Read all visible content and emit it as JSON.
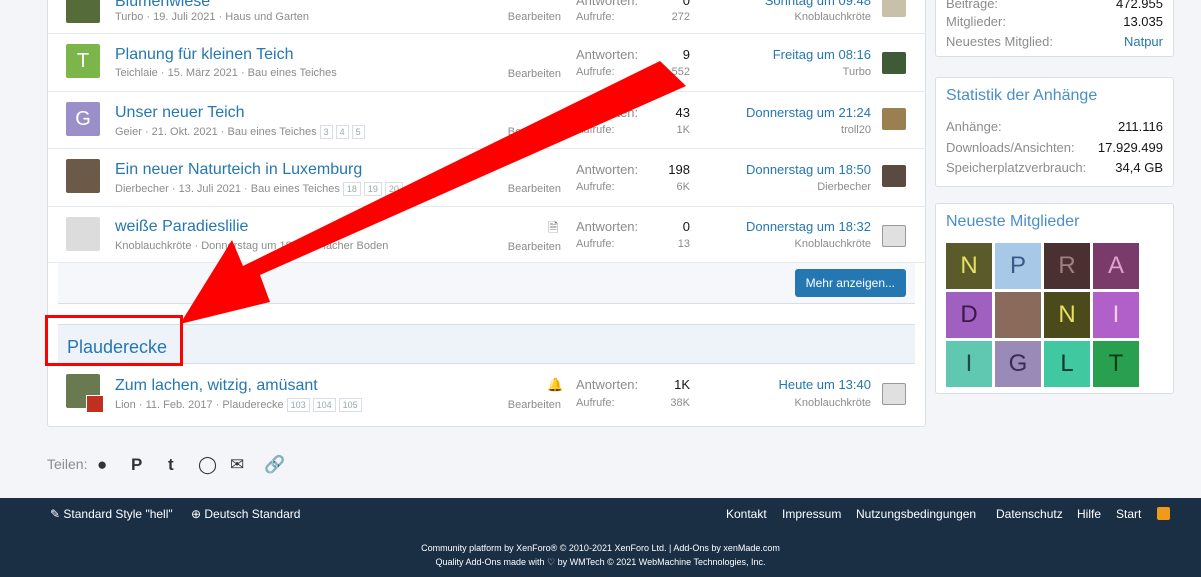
{
  "threads": [
    {
      "title": "Blumenwiese",
      "meta": "Turbo · 19. Juli 2021 · Haus und Garten",
      "edit": "Bearbeiten",
      "replies_label": "Antworten:",
      "replies": "0",
      "views_label": "Aufrufe:",
      "views": "272",
      "last_date": "Sonntag um 09:48",
      "last_user": "Knoblauchkröte",
      "avatar_color": "#556b3a"
    },
    {
      "title": "Planung für kleinen Teich",
      "meta": "Teichlaie · 15. März 2021 · Bau eines Teiches",
      "edit": "Bearbeiten",
      "replies_label": "Antworten:",
      "replies": "9",
      "views_label": "Aufrufe:",
      "views": "552",
      "last_date": "Freitag um 08:16",
      "last_user": "Turbo",
      "avatar_letter": "T",
      "avatar_color": "#7cb54a"
    },
    {
      "title": "Unser neuer Teich",
      "meta": "Geier · 21. Okt. 2021 · Bau eines Teiches",
      "pages": [
        "3",
        "4",
        "5"
      ],
      "edit": "Bearbeiten",
      "replies_label": "Antworten:",
      "replies": "43",
      "views_label": "Aufrufe:",
      "views": "1K",
      "last_date": "Donnerstag um 21:24",
      "last_user": "troll20",
      "avatar_letter": "G",
      "avatar_color": "#9a8fc8"
    },
    {
      "title": "Ein neuer Naturteich in Luxemburg",
      "meta": "Dierbecher · 13. Juli 2021 · Bau eines Teiches",
      "pages": [
        "18",
        "19",
        "20"
      ],
      "edit": "Bearbeiten",
      "replies_label": "Antworten:",
      "replies": "198",
      "views_label": "Aufrufe:",
      "views": "6K",
      "last_date": "Donnerstag um 18:50",
      "last_user": "Dierbecher",
      "avatar_color": "#6b5a48"
    },
    {
      "title": "weiße Paradieslilie",
      "meta": "Knoblauchkröte · Donnerstag um 18:32 · Flacher Boden",
      "edit": "Bearbeiten",
      "replies_label": "Antworten:",
      "replies": "0",
      "views_label": "Aufrufe:",
      "views": "13",
      "last_date": "Donnerstag um 18:32",
      "last_user": "Knoblauchkröte",
      "avatar_color": "#ddd"
    }
  ],
  "more_button": "Mehr anzeigen...",
  "section_title": "Plauderecke",
  "section_thread": {
    "title": "Zum lachen, witzig, amüsant",
    "meta": "Lion · 11. Feb. 2017 · Plauderecke",
    "pages": [
      "103",
      "104",
      "105"
    ],
    "edit": "Bearbeiten",
    "replies_label": "Antworten:",
    "replies": "1K",
    "views_label": "Aufrufe:",
    "views": "38K",
    "last_date": "Heute um 13:40",
    "last_user": "Knoblauchkröte"
  },
  "stats": {
    "rows": [
      {
        "k": "Beiträge:",
        "v": "472.955"
      },
      {
        "k": "Mitglieder:",
        "v": "13.035"
      },
      {
        "k": "Neuestes Mitglied:",
        "v": "Natpur"
      }
    ]
  },
  "attach": {
    "title": "Statistik der Anhänge",
    "rows": [
      {
        "k": "Anhänge:",
        "v": "211.116"
      },
      {
        "k": "Downloads/Ansichten:",
        "v": "17.929.499"
      },
      {
        "k": "Speicherplatzverbrauch:",
        "v": "34,4 GB"
      }
    ]
  },
  "members": {
    "title": "Neueste Mitglieder",
    "tiles": [
      {
        "l": "N",
        "bg": "#5a5a2a",
        "fg": "#e8e060"
      },
      {
        "l": "P",
        "bg": "#a8c8e8",
        "fg": "#3a5a8a"
      },
      {
        "l": "R",
        "bg": "#4a3030",
        "fg": "#a08080"
      },
      {
        "l": "A",
        "bg": "#7a3a6a",
        "fg": "#e0a0d0"
      },
      {
        "l": "D",
        "bg": "#a060c0",
        "fg": "#3a1a4a"
      },
      {
        "l": "",
        "bg": "#8a6a5a",
        "fg": "#fff"
      },
      {
        "l": "N",
        "bg": "#4a4a1a",
        "fg": "#e8e060"
      },
      {
        "l": "I",
        "bg": "#b060c8",
        "fg": "#f0d0f0"
      },
      {
        "l": "I",
        "bg": "#60c8b0",
        "fg": "#1a4a40"
      },
      {
        "l": "G",
        "bg": "#9a8ab8",
        "fg": "#3a2a5a"
      },
      {
        "l": "L",
        "bg": "#40c8a0",
        "fg": "#0a3a2a"
      },
      {
        "l": "T",
        "bg": "#28a050",
        "fg": "#0a3a1a"
      }
    ]
  },
  "share_label": "Teilen:",
  "footer": {
    "style": "Standard Style \"hell\"",
    "lang": "Deutsch Standard",
    "links": [
      "Kontakt",
      "Impressum",
      "Nutzungsbedingungen",
      "Datenschutz",
      "Hilfe",
      "Start"
    ],
    "copy1": "Community platform by XenForo® © 2010-2021 XenForo Ltd. | Add-Ons by xenMade.com",
    "copy2": "Quality Add-Ons made with ♡ by WMTech © 2021 WebMachine Technologies, Inc."
  },
  "colors": {
    "link": "#2577b1",
    "annotation": "#ff0000",
    "footer_bg": "#1a2e44"
  }
}
